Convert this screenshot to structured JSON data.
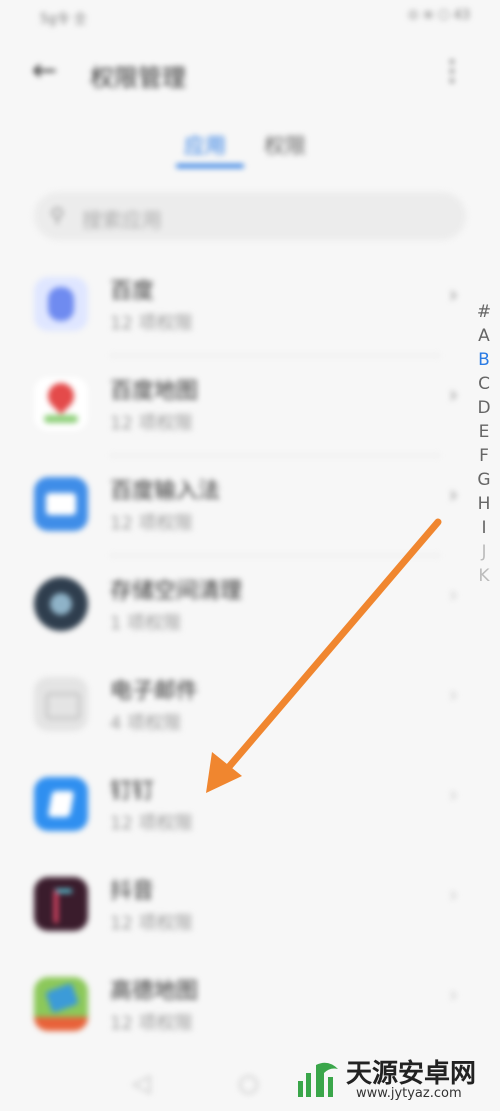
{
  "status_bar": {
    "left": "5g令 仝",
    "right": "⊙ ≋ ⬡ 43"
  },
  "header": {
    "title": "权限管理",
    "back_icon": "arrow-left-icon",
    "more_icon": "more-vertical-icon"
  },
  "tabs": [
    {
      "label": "应用",
      "active": true
    },
    {
      "label": "权限",
      "active": false
    }
  ],
  "search": {
    "placeholder": "搜索应用"
  },
  "apps": [
    {
      "name": "百度",
      "sub": "12 项权限",
      "icon_color": "#6f8bf0"
    },
    {
      "name": "百度地图",
      "sub": "12 项权限",
      "icon_color": "#e44a4a"
    },
    {
      "name": "百度输入法",
      "sub": "12 项权限",
      "icon_color": "#3f8de8"
    },
    {
      "name": "存储空间清理",
      "sub": "1 项权限",
      "icon_color": "#2f3e4e"
    },
    {
      "name": "电子邮件",
      "sub": "4 项权限",
      "icon_color": "#d8d8d8"
    },
    {
      "name": "钉钉",
      "sub": "12 项权限",
      "icon_color": "#2f8ff0"
    },
    {
      "name": "抖音",
      "sub": "12 项权限",
      "icon_color": "#3a1c2c"
    },
    {
      "name": "高德地图",
      "sub": "12 项权限",
      "icon_color": "#3c9bd8"
    }
  ],
  "index_letters": [
    "#",
    "A",
    "B",
    "C",
    "D",
    "E",
    "F",
    "G",
    "H",
    "I",
    "J",
    "K"
  ],
  "index_active": "B",
  "annotation": {
    "color": "#f0862f",
    "points_to": "钉钉"
  },
  "watermark": {
    "text": "天源安卓网",
    "url": "www.jytyaz.com",
    "logo_color": "#3aa64a"
  }
}
